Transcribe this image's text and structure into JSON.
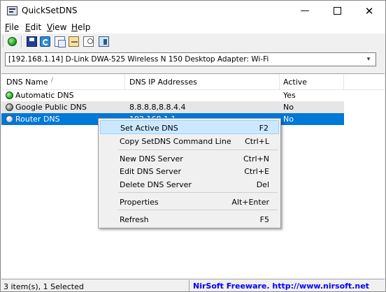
{
  "window": {
    "title": "QuickSetDNS",
    "minimize": "—",
    "close": "✕"
  },
  "menubar": {
    "items": [
      "File",
      "Edit",
      "View",
      "Help"
    ]
  },
  "toolbar": {
    "icons": [
      "green-circle-icon",
      "save-icon",
      "refresh-icon",
      "copy-icon",
      "properties-icon",
      "find-icon",
      "exit-icon"
    ]
  },
  "adapter": {
    "value": "[192.168.1.14]  D-Link DWA-525 Wireless N 150 Desktop Adapter: Wi-Fi",
    "arrow": "▾"
  },
  "list": {
    "columns": [
      "DNS Name",
      "DNS IP Addresses",
      "Active"
    ],
    "sort_indicator": "/",
    "rows": [
      {
        "name": "Automatic DNS",
        "ip": "",
        "active": "Yes",
        "status_icon": "green-dot-icon"
      },
      {
        "name": "Google Public DNS",
        "ip": "8.8.8.8,8.8.4.4",
        "active": "No",
        "status_icon": "gray-dot-icon"
      },
      {
        "name": "Router DNS",
        "ip": "192.168.1.1",
        "active": "No",
        "status_icon": "white-dot-icon",
        "selected": true
      }
    ]
  },
  "context_menu": {
    "items": [
      {
        "label": "Set Active DNS",
        "shortcut": "F2",
        "highlighted": true
      },
      {
        "label": "Copy SetDNS Command Line",
        "shortcut": "Ctrl+L"
      },
      {
        "label": "New DNS Server",
        "shortcut": "Ctrl+N"
      },
      {
        "label": "Edit DNS Server",
        "shortcut": "Ctrl+E"
      },
      {
        "label": "Delete DNS Server",
        "shortcut": "Del"
      },
      {
        "label": "Properties",
        "shortcut": "Alt+Enter"
      },
      {
        "label": "Refresh",
        "shortcut": "F5"
      }
    ]
  },
  "statusbar": {
    "count": "3 item(s), 1 Selected",
    "link": "NirSoft Freeware.  http://www.nirsoft.net"
  },
  "colors": {
    "selection": "#0078d7",
    "menu_highlight": "#cce8ff",
    "link": "#0000ff"
  }
}
